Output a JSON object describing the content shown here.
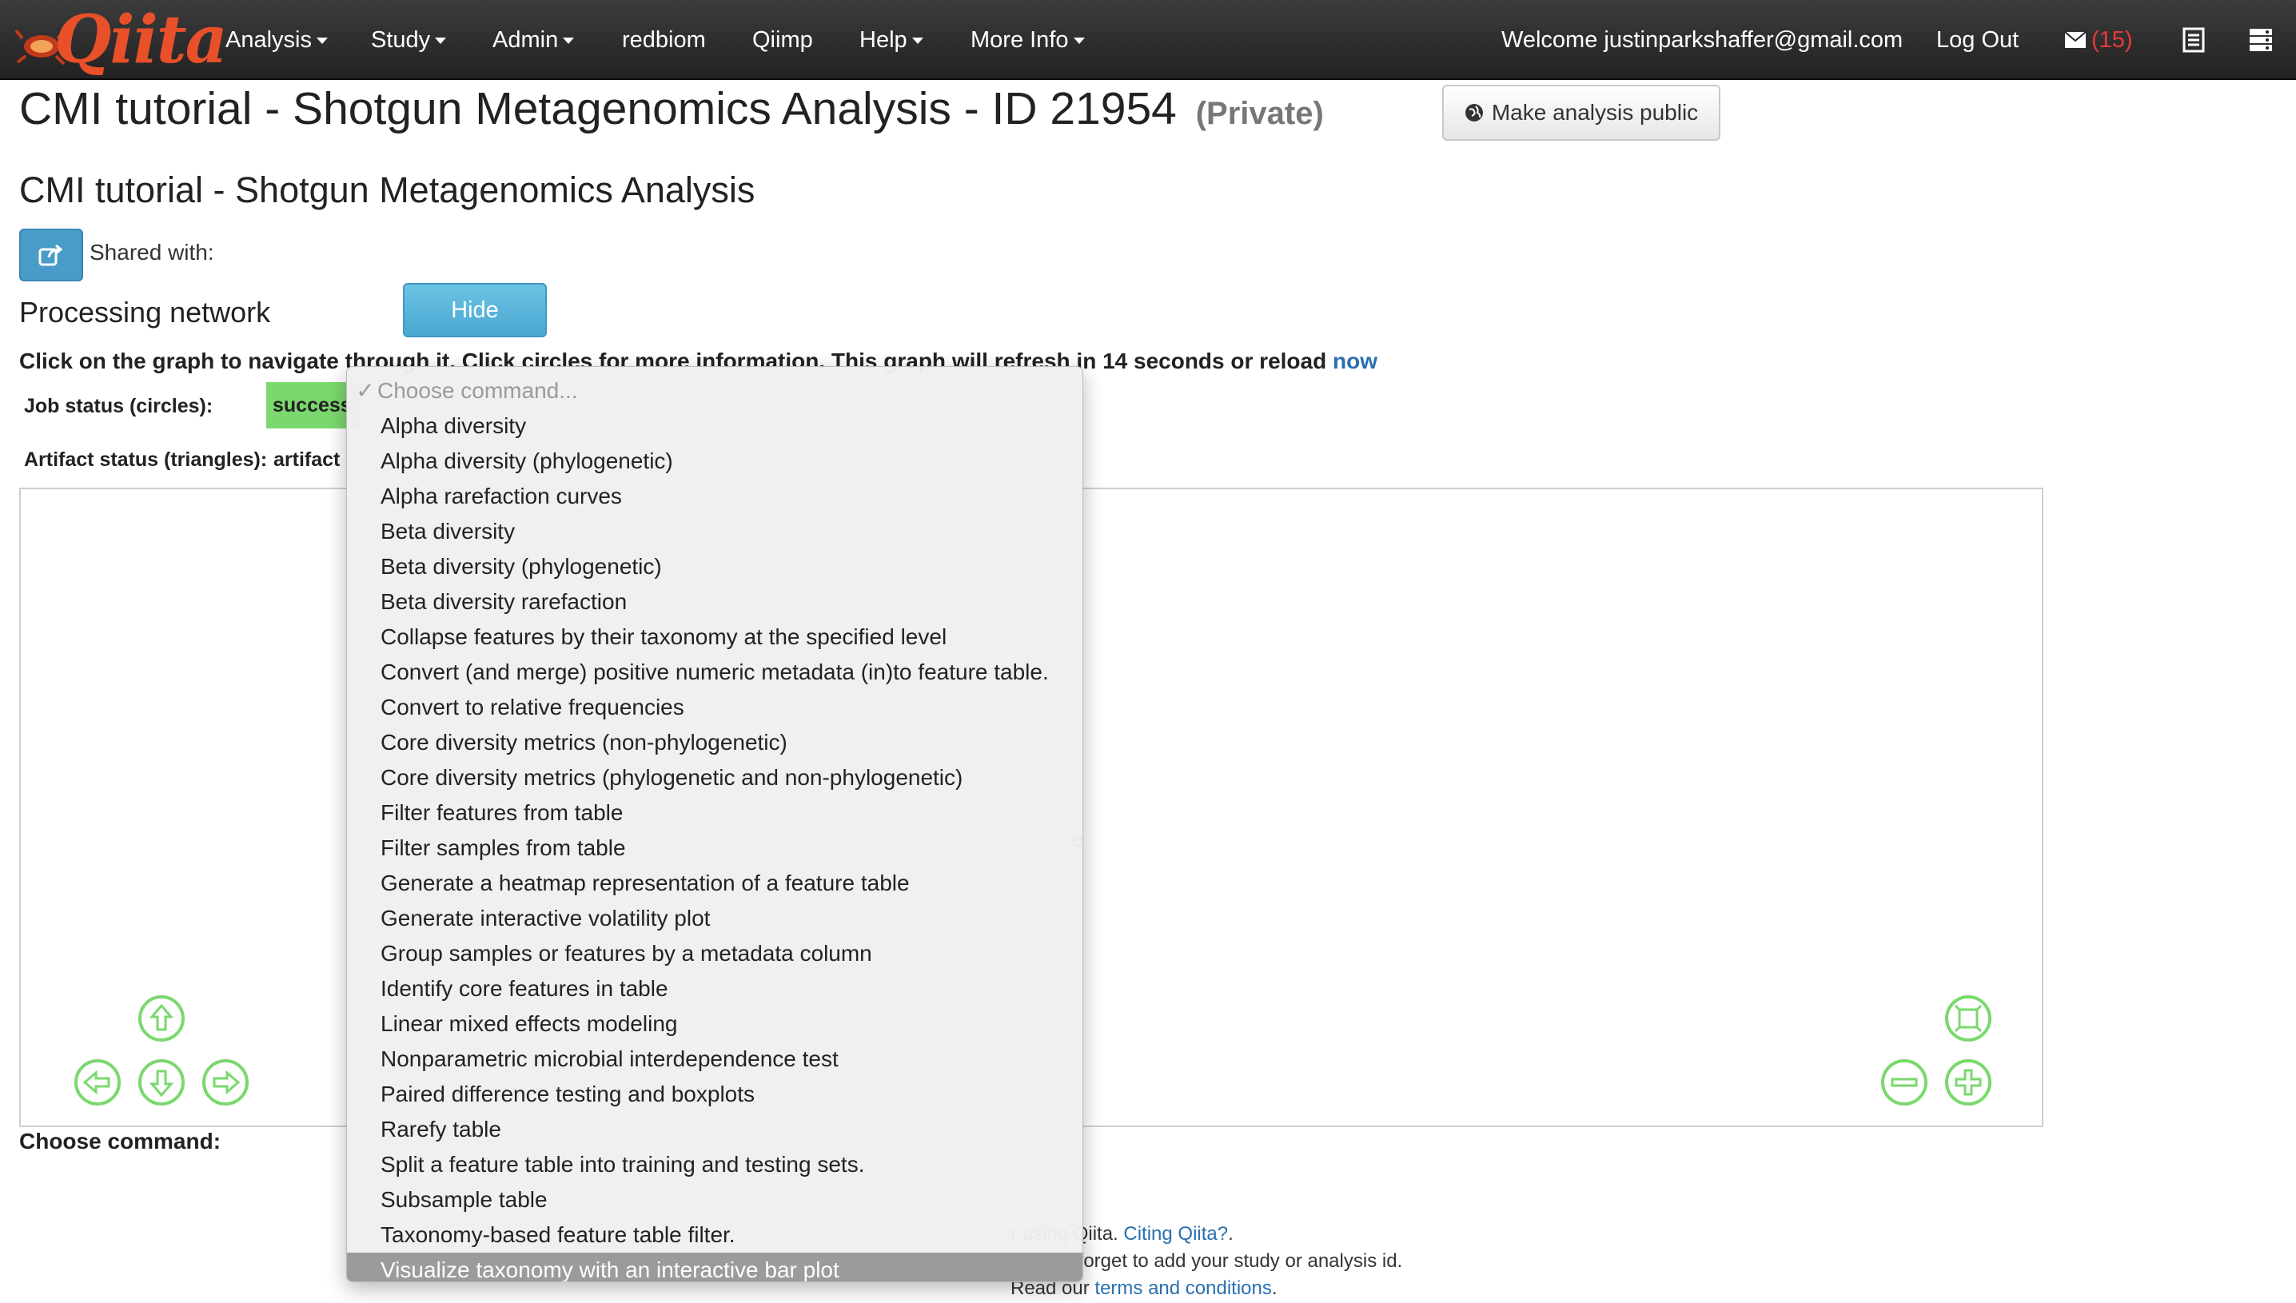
{
  "navbar": {
    "brand": "Qiita",
    "menu": [
      {
        "label": "Analysis",
        "dropdown": true
      },
      {
        "label": "Study",
        "dropdown": true
      },
      {
        "label": "Admin",
        "dropdown": true
      },
      {
        "label": "redbiom",
        "dropdown": false
      },
      {
        "label": "Qiimp",
        "dropdown": false
      },
      {
        "label": "Help",
        "dropdown": true
      },
      {
        "label": "More Info",
        "dropdown": true
      }
    ],
    "welcome": "Welcome justinparkshaffer@gmail.com",
    "logout": "Log Out",
    "message_count": "(15)",
    "icons": [
      "envelope-icon",
      "list-icon",
      "server-icon"
    ]
  },
  "header": {
    "title": "CMI tutorial - Shotgun Metagenomics Analysis - ID 21954",
    "privacy": "(Private)",
    "make_public_label": "Make analysis public",
    "subtitle": "CMI tutorial - Shotgun Metagenomics Analysis",
    "shared_with_label": "Shared with:"
  },
  "processing": {
    "section_title": "Processing network",
    "hide_label": "Hide",
    "instructions": "Click on the graph to navigate through it. Click circles for more information. This graph will refresh in 14 seconds or reload",
    "reload_link": "now",
    "job_status_label": "Job status (circles):",
    "job_status_value": "success",
    "artifact_status_label": "Artifact status (triangles):",
    "artifact_status_value": "artifact",
    "graph_fragment": "e"
  },
  "choose_command_label": "Choose command:",
  "dropdown": {
    "placeholder": "Choose command...",
    "check_mark": "✓",
    "options": [
      "Alpha diversity",
      "Alpha diversity (phylogenetic)",
      "Alpha rarefaction curves",
      "Beta diversity",
      "Beta diversity (phylogenetic)",
      "Beta diversity rarefaction",
      "Collapse features by their taxonomy at the specified level",
      "Convert (and merge) positive numeric metadata (in)to feature table.",
      "Convert to relative frequencies",
      "Core diversity metrics (non-phylogenetic)",
      "Core diversity metrics (phylogenetic and non-phylogenetic)",
      "Filter features from table",
      "Filter samples from table",
      "Generate a heatmap representation of a feature table",
      "Generate interactive volatility plot",
      "Group samples or features by a metadata column",
      "Identify core features in table",
      "Linear mixed effects modeling",
      "Nonparametric microbial interdependence test",
      "Paired difference testing and boxplots",
      "Rarefy table",
      "Split a feature table into training and testing sets.",
      "Subsample table",
      "Taxonomy-based feature table filter.",
      "Visualize taxonomy with an interactive bar plot"
    ],
    "highlighted": "Visualize taxonomy with an interactive bar plot"
  },
  "footer": {
    "line1_text": "r using Qiita.",
    "line1_link": "Citing Qiita?",
    "line1_end": ".",
    "line2_link": "n",
    "line2_text": "; don't forget to add your study or analysis id.",
    "line3_text": "Read our",
    "line3_link": "terms and conditions",
    "line3_end": "."
  },
  "colors": {
    "navbar": "#222222",
    "brand": "#e8502a",
    "accent_blue": "#4aa8d2",
    "success_green": "#7bd86e",
    "graph_control_green": "#7bd86e",
    "message_red": "#e53c3c",
    "link_blue": "#2a6fb0"
  }
}
